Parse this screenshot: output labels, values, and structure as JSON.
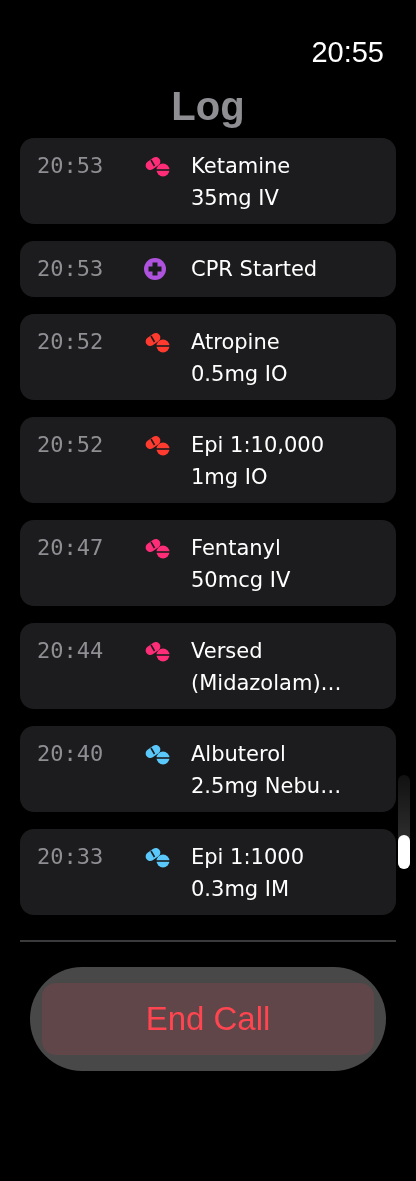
{
  "status_bar": {
    "time": "20:55"
  },
  "title": "Log",
  "entries": [
    {
      "time": "20:53",
      "kind": "medication",
      "color": "#ff2d78",
      "lines": [
        "Ketamine",
        "35mg IV"
      ]
    },
    {
      "time": "20:53",
      "kind": "procedure",
      "color": "#af52de",
      "lines": [
        "CPR Started"
      ]
    },
    {
      "time": "20:52",
      "kind": "medication",
      "color": "#ff3b30",
      "lines": [
        "Atropine",
        "0.5mg IO"
      ]
    },
    {
      "time": "20:52",
      "kind": "medication",
      "color": "#ff3b30",
      "lines": [
        "Epi 1:10,000",
        "1mg IO"
      ]
    },
    {
      "time": "20:47",
      "kind": "medication",
      "color": "#ff2d78",
      "lines": [
        "Fentanyl",
        "50mcg IV"
      ]
    },
    {
      "time": "20:44",
      "kind": "medication",
      "color": "#ff2d78",
      "lines": [
        "Versed",
        "(Midazolam)…"
      ]
    },
    {
      "time": "20:40",
      "kind": "medication",
      "color": "#5ac8fa",
      "lines": [
        "Albuterol",
        "2.5mg Nebu…"
      ]
    },
    {
      "time": "20:33",
      "kind": "medication",
      "color": "#5ac8fa",
      "lines": [
        "Epi 1:1000",
        "0.3mg IM"
      ]
    }
  ],
  "end_button": {
    "label": "End Call"
  }
}
